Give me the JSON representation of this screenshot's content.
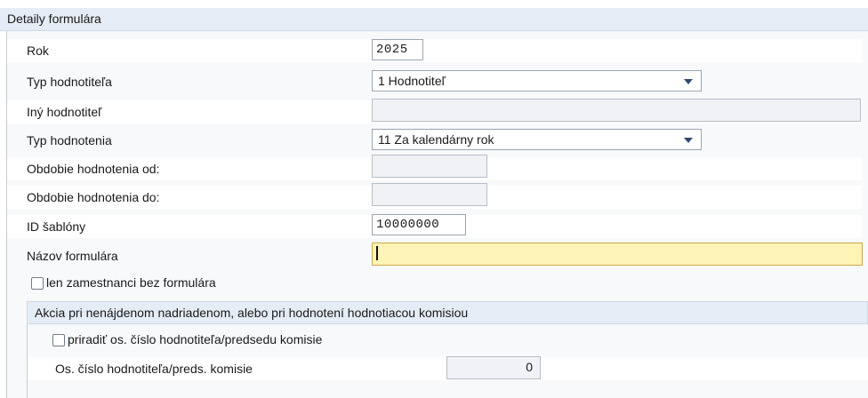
{
  "panel": {
    "title": "Detaily formulára"
  },
  "fields": {
    "rok": {
      "label": "Rok",
      "value": "2025"
    },
    "typ_hodnotitela": {
      "label": "Typ hodnotiteľa",
      "value": "1 Hodnotiteľ"
    },
    "iny_hodnotitel": {
      "label": "Iný hodnotiteľ",
      "value": ""
    },
    "typ_hodnotenia": {
      "label": "Typ hodnotenia",
      "value": "11 Za kalendárny rok"
    },
    "obdobie_od": {
      "label": "Obdobie hodnotenia od:",
      "value": ""
    },
    "obdobie_do": {
      "label": "Obdobie hodnotenia do:",
      "value": ""
    },
    "id_sablony": {
      "label": "ID šablóny",
      "value": "10000000"
    },
    "nazov_formulara": {
      "label": "Názov formulára",
      "value": ""
    }
  },
  "checkbox_len_zamestnanci": {
    "label": "len zamestnanci bez formulára",
    "checked": false
  },
  "subsection": {
    "title": "Akcia pri nenájdenom nadriadenom, alebo pri hodnotení hodnotiacou komisiou",
    "checkbox_priradit": {
      "label": "priradiť os. číslo hodnotiteľa/predsedu komisie",
      "checked": false
    },
    "os_cislo": {
      "label": "Os. číslo hodnotiteľa/preds. komisie",
      "value": "0"
    }
  },
  "colors": {
    "header_bg": "#e4ecf5",
    "focus_bg": "#fff3b5",
    "caret": "#2e4a6e"
  }
}
